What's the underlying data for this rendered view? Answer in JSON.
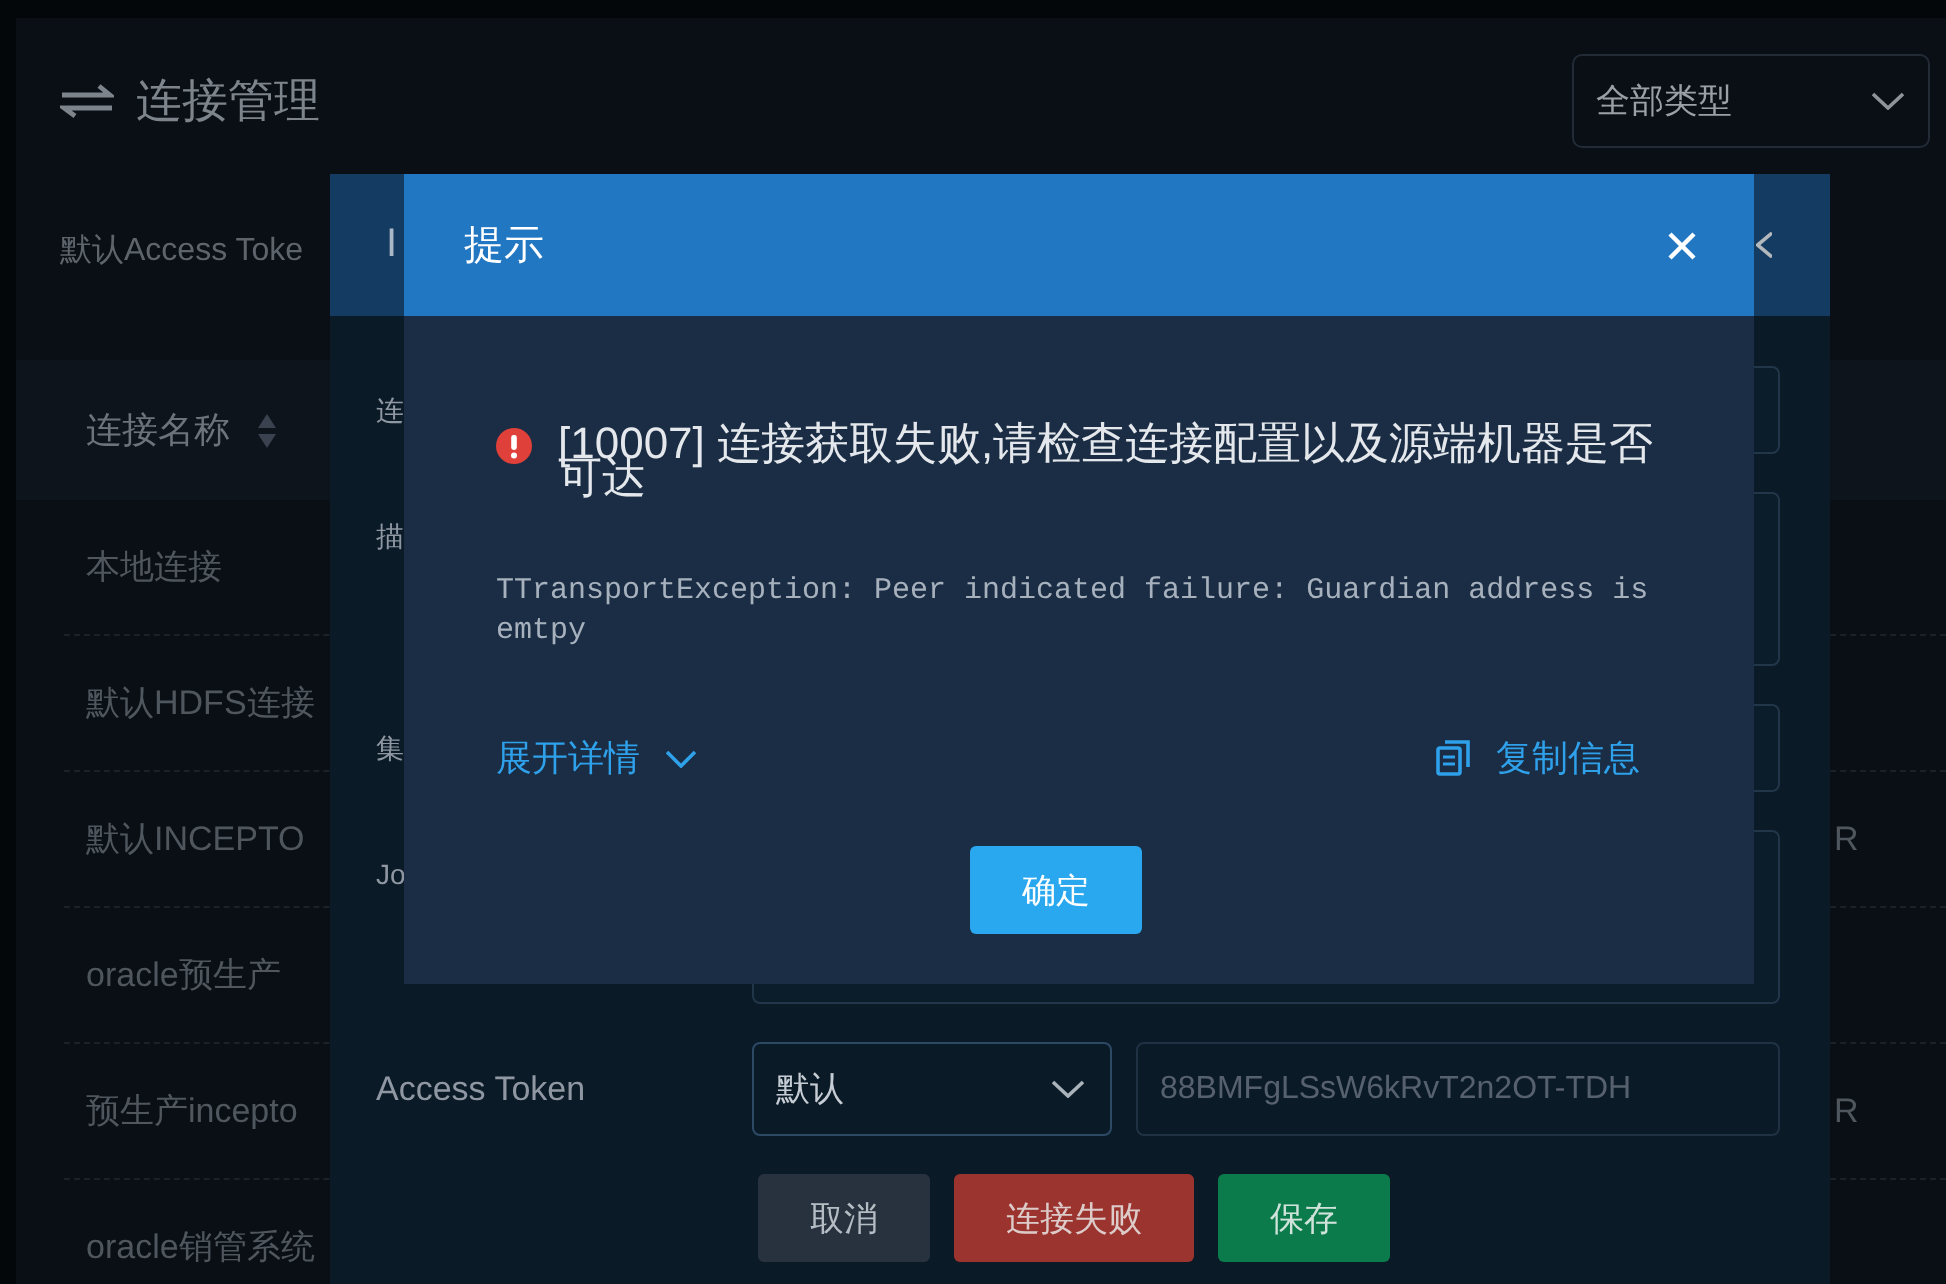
{
  "page": {
    "title": "连接管理",
    "type_filter": {
      "value": "全部类型"
    },
    "access_token_note": "默认Access Toke"
  },
  "table": {
    "columns": [
      {
        "label": "连接名称",
        "sortable": true
      }
    ],
    "rows": [
      {
        "name": "本地连接"
      },
      {
        "name": "默认HDFS连接"
      },
      {
        "name": "默认INCEPTO",
        "column_2": "R"
      },
      {
        "name": "oracle预生产"
      },
      {
        "name": "预生产incepto",
        "column_2": "R"
      },
      {
        "name": "oracle销管系统"
      }
    ]
  },
  "edit_dialog": {
    "title": "I",
    "fields": [
      {
        "label": "连",
        "kind": "input"
      },
      {
        "label": "描",
        "kind": "textarea"
      },
      {
        "label": "集",
        "kind": "input"
      },
      {
        "label": "Jo",
        "kind": "textarea"
      },
      {
        "label": "Access Token",
        "kind": "token",
        "select": {
          "value": "默认"
        },
        "input": {
          "value": "88BMFgLSsW6kRvT2n2OT-TDH",
          "disabled": true
        }
      }
    ],
    "buttons": [
      {
        "label": "取消",
        "kind": "cancel"
      },
      {
        "label": "连接失败",
        "kind": "danger"
      },
      {
        "label": "保存",
        "kind": "primary"
      }
    ]
  },
  "alert": {
    "title": "提示",
    "message": "[10007] 连接获取失败,请检查连接配置以及源端机器是否可达",
    "detail": "TTransportException: Peer indicated failure: Guardian address is emtpy",
    "expand_link": "展开详情",
    "expanded": false,
    "copy_link": "复制信息",
    "confirm_button": "确定"
  }
}
